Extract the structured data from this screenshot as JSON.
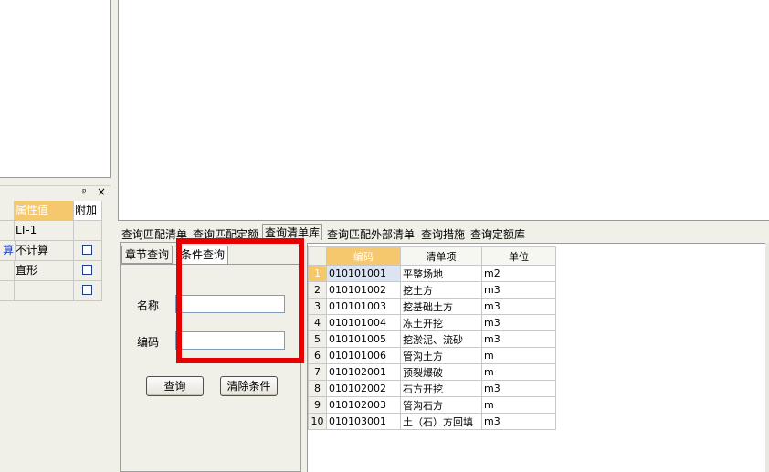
{
  "property_panel": {
    "header_col_value": "属性值",
    "header_col_extra": "附加",
    "pin_glyph": "ᵖ",
    "close_glyph": "×",
    "rows": [
      {
        "edge": "",
        "value": "LT-1",
        "checkbox": false
      },
      {
        "edge": "算",
        "value": "不计算",
        "checkbox": true
      },
      {
        "edge": "",
        "value": "直形",
        "checkbox": true
      },
      {
        "edge": "",
        "value": "",
        "checkbox": true
      }
    ]
  },
  "query_tabs": [
    "查询匹配清单",
    "查询匹配定额",
    "查询清单库",
    "查询匹配外部清单",
    "查询措施",
    "查询定额库"
  ],
  "active_query_tab": "查询清单库",
  "sub_tabs": [
    "章节查询",
    "条件查询"
  ],
  "active_sub_tab": "条件查询",
  "form": {
    "name_label": "名称",
    "code_label": "编码",
    "name_value": "",
    "code_value": "",
    "query_button": "查询",
    "clear_button": "清除条件"
  },
  "table": {
    "columns": [
      "编码",
      "清单项",
      "单位"
    ],
    "rows": [
      {
        "no": "1",
        "code": "010101001",
        "item": "平整场地",
        "unit": "m2"
      },
      {
        "no": "2",
        "code": "010101002",
        "item": "挖土方",
        "unit": "m3"
      },
      {
        "no": "3",
        "code": "010101003",
        "item": "挖基础土方",
        "unit": "m3"
      },
      {
        "no": "4",
        "code": "010101004",
        "item": "冻土开挖",
        "unit": "m3"
      },
      {
        "no": "5",
        "code": "010101005",
        "item": "挖淤泥、流砂",
        "unit": "m3"
      },
      {
        "no": "6",
        "code": "010101006",
        "item": "管沟土方",
        "unit": "m"
      },
      {
        "no": "7",
        "code": "010102001",
        "item": "预裂爆破",
        "unit": "m"
      },
      {
        "no": "8",
        "code": "010102002",
        "item": "石方开挖",
        "unit": "m3"
      },
      {
        "no": "9",
        "code": "010102003",
        "item": "管沟石方",
        "unit": "m"
      },
      {
        "no": "10",
        "code": "010103001",
        "item": "土（石）方回填",
        "unit": "m3"
      }
    ]
  },
  "colors": {
    "header_highlight": "#f5c86e",
    "highlight_box": "#e60000"
  }
}
